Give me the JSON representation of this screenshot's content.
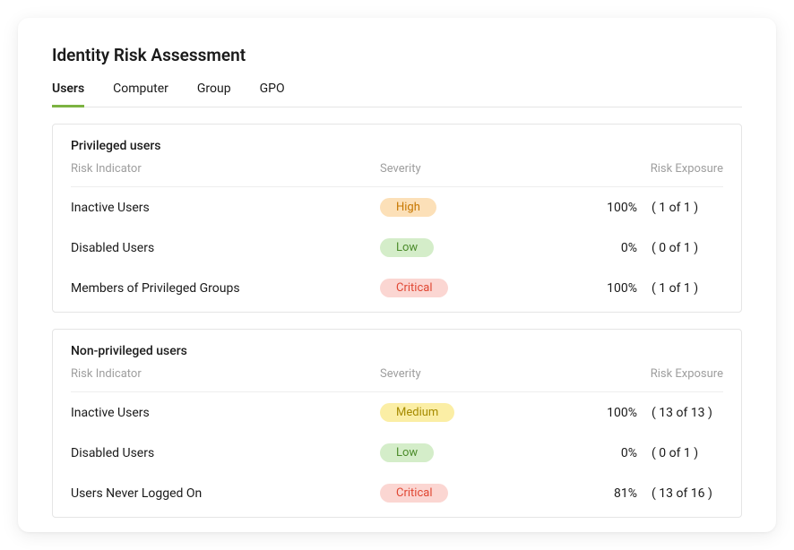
{
  "title": "Identity Risk Assessment",
  "tabs": [
    {
      "label": "Users",
      "active": true
    },
    {
      "label": "Computer",
      "active": false
    },
    {
      "label": "Group",
      "active": false
    },
    {
      "label": "GPO",
      "active": false
    }
  ],
  "columns": {
    "indicator": "Risk Indicator",
    "severity": "Severity",
    "exposure": "Risk Exposure"
  },
  "sections": [
    {
      "title": "Privileged users",
      "rows": [
        {
          "indicator": "Inactive Users",
          "severity": "High",
          "severityClass": "badge-high",
          "percent": "100%",
          "count": "( 1 of 1 )"
        },
        {
          "indicator": "Disabled Users",
          "severity": "Low",
          "severityClass": "badge-low",
          "percent": "0%",
          "count": "( 0 of 1 )"
        },
        {
          "indicator": "Members of Privileged Groups",
          "severity": "Critical",
          "severityClass": "badge-critical",
          "percent": "100%",
          "count": "( 1 of 1 )"
        }
      ]
    },
    {
      "title": "Non-privileged users",
      "rows": [
        {
          "indicator": "Inactive Users",
          "severity": "Medium",
          "severityClass": "badge-medium",
          "percent": "100%",
          "count": "( 13 of 13 )"
        },
        {
          "indicator": "Disabled Users",
          "severity": "Low",
          "severityClass": "badge-low",
          "percent": "0%",
          "count": "( 0 of 1 )"
        },
        {
          "indicator": "Users Never Logged On",
          "severity": "Critical",
          "severityClass": "badge-critical",
          "percent": "81%",
          "count": "( 13 of 16 )"
        }
      ]
    }
  ]
}
